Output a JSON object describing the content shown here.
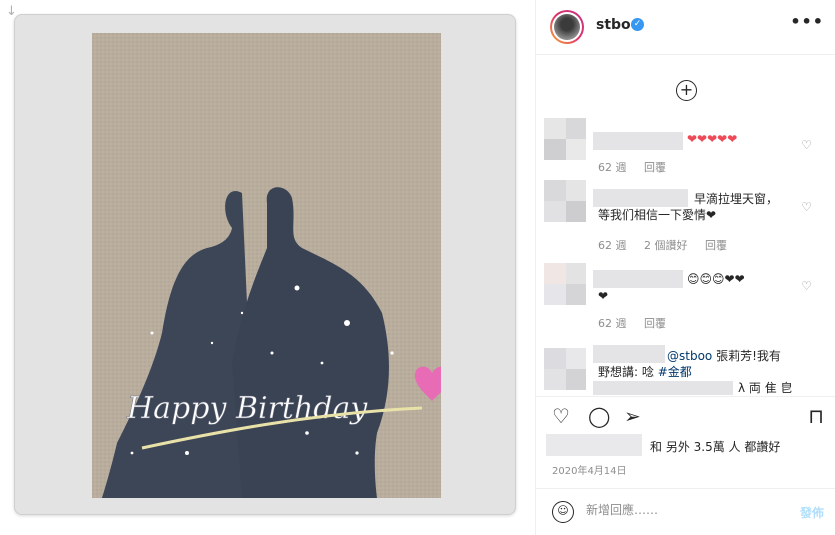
{
  "page": {
    "download_arrow": "↓"
  },
  "photo": {
    "overlay_text": "Happy Birthday"
  },
  "header": {
    "username": "stboo",
    "verified_mark": "✓",
    "more": "•••"
  },
  "load_more": "+",
  "comments": [
    {
      "text": "❤❤❤❤❤",
      "time": "62 週",
      "likes": "",
      "reply": "回覆"
    },
    {
      "text": "早滴拉埋天窗，\n等我们相信一下愛情❤",
      "time": "62 週",
      "likes": "2 個讚好",
      "reply": "回覆"
    },
    {
      "text": "😊😊😊❤❤",
      "text2": "❤",
      "time": "62 週",
      "likes": "",
      "reply": "回覆"
    },
    {
      "mention": "@stboo",
      "text": " 張莉芳!我有",
      "text2": "野想講: 唸 ",
      "hashtag": "#金都",
      "text3": "λ 両 隹 皀"
    }
  ],
  "icons": {
    "like": "heart-outline-icon",
    "comment": "comment-icon",
    "share": "paper-plane-icon",
    "save": "bookmark-icon"
  },
  "likes": {
    "text": "和 另外 3.5萬 人 都讚好"
  },
  "date": "2020年4月14日",
  "add_comment": {
    "placeholder": "新增回應……",
    "post_label": "發佈",
    "emoji": "☺"
  },
  "colors": {
    "accent": "#3897f0",
    "heart": "#ed4956",
    "meta": "#8e8e8e"
  }
}
